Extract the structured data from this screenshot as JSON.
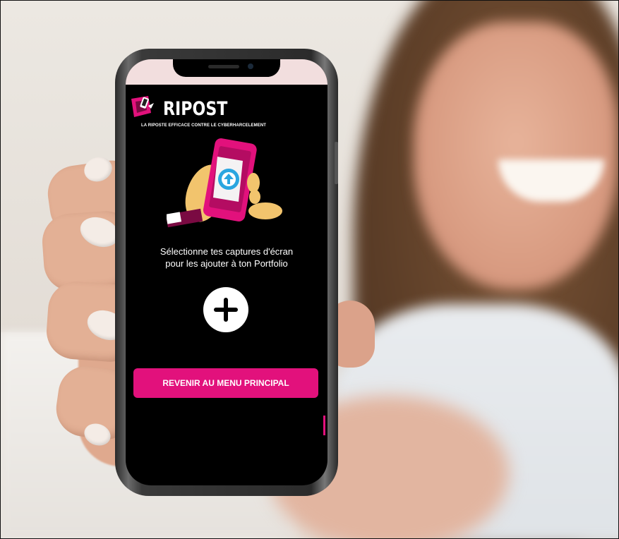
{
  "app": {
    "title": "RIPOST",
    "tagline": "LA RIPOSTE EFFICACE CONTRE LE CYBERHARCELEMENT"
  },
  "upload": {
    "instruction_line1": "Sélectionne tes captures d'écran",
    "instruction_line2": "pour les ajouter à ton Portfolio",
    "add_icon": "plus-icon"
  },
  "actions": {
    "back_to_menu_label": "REVENIR AU MENU PRINCIPAL"
  },
  "colors": {
    "accent": "#e2117c",
    "screen_background": "#000000",
    "status_bar": "#f2dede"
  },
  "icons": {
    "logo": "ripost-logo-icon",
    "illustration": "phone-upload-illustration-icon"
  }
}
